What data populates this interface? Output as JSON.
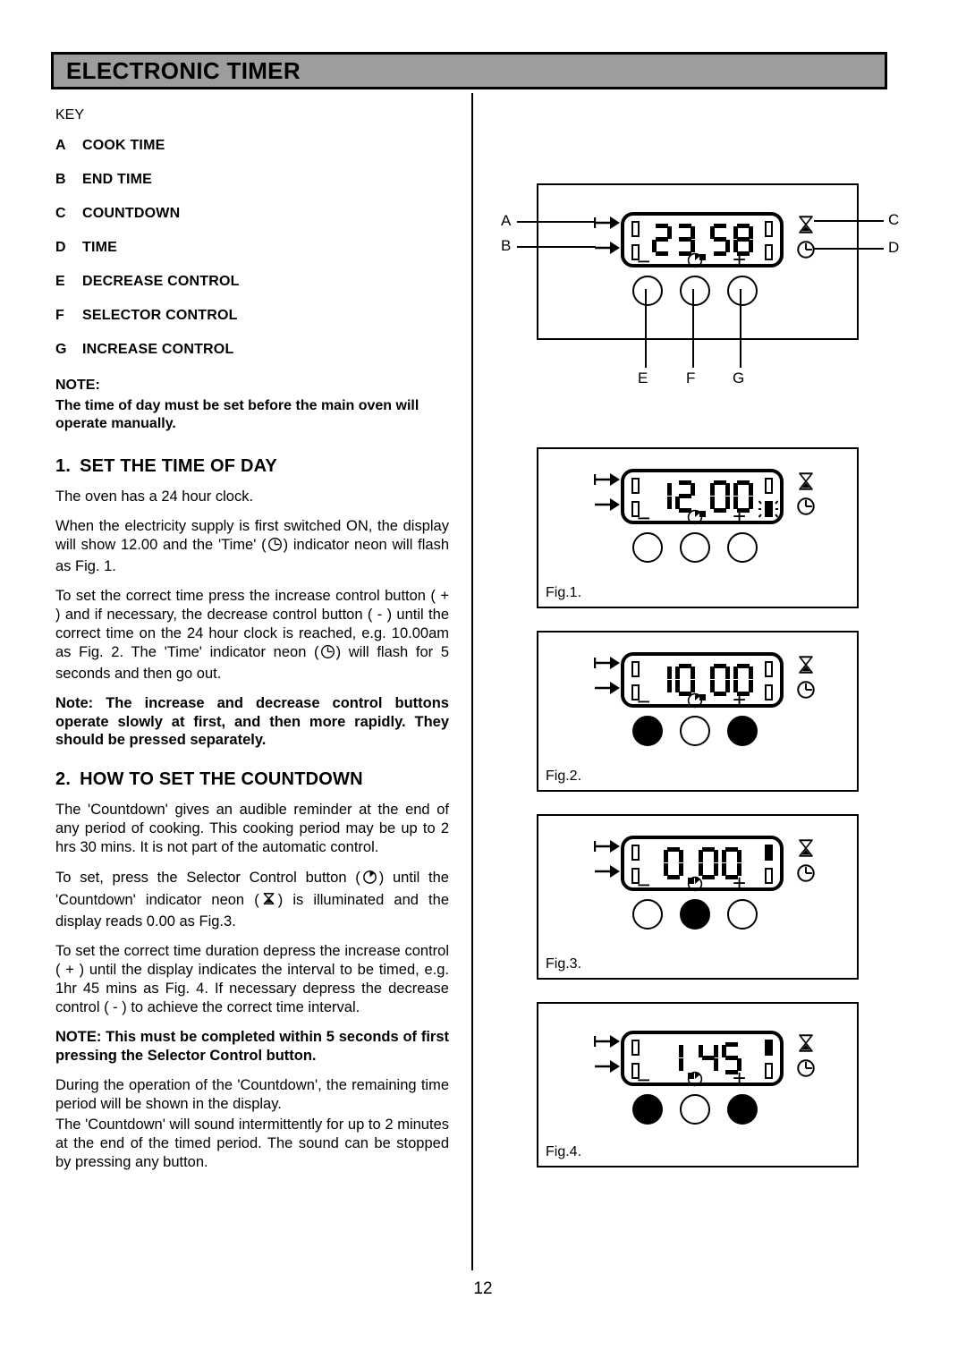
{
  "header": {
    "title": "ELECTRONIC TIMER"
  },
  "key": {
    "label": "KEY",
    "items": [
      {
        "letter": "A",
        "text": "COOK TIME"
      },
      {
        "letter": "B",
        "text": "END TIME"
      },
      {
        "letter": "C",
        "text": "COUNTDOWN"
      },
      {
        "letter": "D",
        "text": "TIME"
      },
      {
        "letter": "E",
        "text": "DECREASE CONTROL"
      },
      {
        "letter": "F",
        "text": "SELECTOR CONTROL"
      },
      {
        "letter": "G",
        "text": "INCREASE CONTROL"
      }
    ]
  },
  "note_top": {
    "heading": "NOTE:",
    "body": "The time of day must be set before the main oven will operate manually."
  },
  "section1": {
    "number": "1.",
    "title": "SET THE TIME OF DAY",
    "p1": "The oven has a 24 hour clock.",
    "p2_a": "When the electricity supply is first switched ON, the display will show 12.00 and the 'Time' (",
    "p2_b": ") indicator neon will flash as Fig. 1.",
    "p3_a": "To set the correct time press the increase control button ( + ) and if necessary, the decrease control button ( - ) until the correct time on the 24 hour clock is reached,   e.g. 10.00am as Fig. 2.   The 'Time' indicator neon (",
    "p3_b": ") will flash for 5 seconds and then go out.",
    "note": "Note: The increase and decrease control buttons operate slowly at first, and then more rapidly. They should be pressed separately."
  },
  "section2": {
    "number": "2.",
    "title": "HOW TO SET THE COUNTDOWN",
    "p1": "The 'Countdown' gives an audible reminder at the end of any period of cooking. This cooking period may be up to 2 hrs 30 mins. It is not part of the automatic control.",
    "p2_a": "To set, press the Selector Control button (",
    "p2_b": ") until the 'Countdown' indicator neon (",
    "p2_c": ") is illuminated and the display reads 0.00 as Fig.3.",
    "p3": "To set the correct time duration depress the increase control ( + ) until the display indicates the interval to be timed, e.g. 1hr 45 mins as Fig. 4.  If necessary depress the decrease control ( - ) to achieve the correct time interval.",
    "note": "NOTE:  This must be completed within 5 seconds of first pressing the Selector Control button.",
    "p4": "During the operation of the 'Countdown', the remaining time period will be shown in the display.",
    "p5": "The 'Countdown' will sound intermittently for up to 2 minutes at the end of the timed period.  The sound can be stopped by pressing any button."
  },
  "diagram_main": {
    "display_value": "23.58",
    "labels": {
      "a": "A",
      "b": "B",
      "c": "C",
      "d": "D",
      "e": "E",
      "f": "F",
      "g": "G"
    },
    "button_symbols": {
      "decrease": "−",
      "selector": "selector-icon",
      "increase": "+"
    },
    "indicator_icons": {
      "countdown": "hourglass-icon",
      "time": "clock-icon"
    }
  },
  "figures": [
    {
      "caption": "Fig.1.",
      "display_value": "12.00",
      "indicator_tl": "outline",
      "indicator_bl": "outline",
      "indicator_tr": "outline",
      "indicator_br": "flashing",
      "btn_decrease": "unpressed",
      "btn_selector": "unpressed",
      "btn_increase": "unpressed"
    },
    {
      "caption": "Fig.2.",
      "display_value": "10.00",
      "indicator_tl": "outline",
      "indicator_bl": "outline",
      "indicator_tr": "outline",
      "indicator_br": "outline",
      "btn_decrease": "pressed",
      "btn_selector": "unpressed",
      "btn_increase": "pressed"
    },
    {
      "caption": "Fig.3.",
      "display_value": "0.00",
      "indicator_tl": "outline",
      "indicator_bl": "outline",
      "indicator_tr": "filled",
      "indicator_br": "outline",
      "btn_decrease": "unpressed",
      "btn_selector": "pressed",
      "btn_increase": "unpressed"
    },
    {
      "caption": "Fig.4.",
      "display_value": "1.45",
      "indicator_tl": "outline",
      "indicator_bl": "outline",
      "indicator_tr": "filled",
      "indicator_br": "outline",
      "btn_decrease": "pressed",
      "btn_selector": "unpressed",
      "btn_increase": "pressed"
    }
  ],
  "page_number": "12",
  "colors": {
    "header_bg": "#9d9d9d",
    "ink": "#000000",
    "paper": "#ffffff"
  }
}
